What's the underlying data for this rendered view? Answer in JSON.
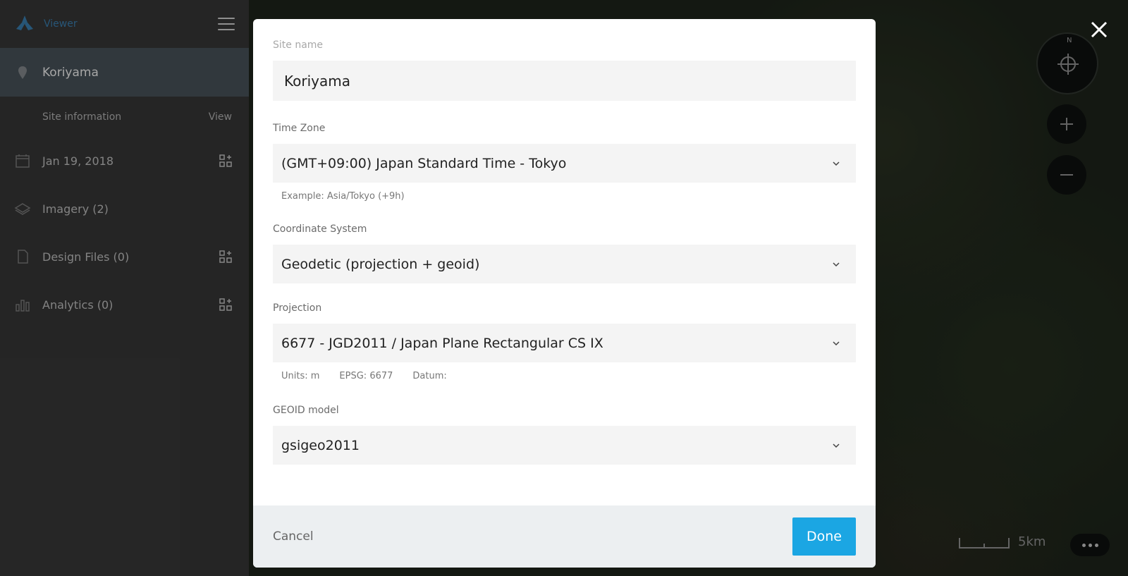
{
  "sidebar": {
    "app_name": "Viewer",
    "site": "Koriyama",
    "site_info_label": "Site information",
    "site_info_action": "View",
    "items": [
      {
        "label": "Jan 19, 2018",
        "icon": "calendar-icon",
        "addable": true
      },
      {
        "label": "Imagery (2)",
        "icon": "layers-icon",
        "addable": false
      },
      {
        "label": "Design Files (0)",
        "icon": "file-icon",
        "addable": true
      },
      {
        "label": "Analytics (0)",
        "icon": "bar-chart-icon",
        "addable": true
      }
    ]
  },
  "map": {
    "compass_label": "N",
    "scale_label": "5km"
  },
  "modal": {
    "site_name_label": "Site name",
    "site_name_value": "Koriyama",
    "time_zone_label": "Time Zone",
    "time_zone_value": "(GMT+09:00) Japan Standard Time - Tokyo",
    "time_zone_hint": "Example: Asia/Tokyo (+9h)",
    "coord_label": "Coordinate System",
    "coord_value": "Geodetic (projection + geoid)",
    "projection_label": "Projection",
    "projection_value": "6677 - JGD2011 / Japan Plane Rectangular CS IX",
    "projection_units": "Units: m",
    "projection_epsg": "EPSG: 6677",
    "projection_datum": "Datum:",
    "geoid_label": "GEOID model",
    "geoid_value": "gsigeo2011",
    "cancel_label": "Cancel",
    "done_label": "Done"
  },
  "colors": {
    "accent": "#1ba6e3",
    "brand": "#3d84b8",
    "sidebar_bg": "#3a3a3a",
    "selected_bg": "#4c575e"
  }
}
